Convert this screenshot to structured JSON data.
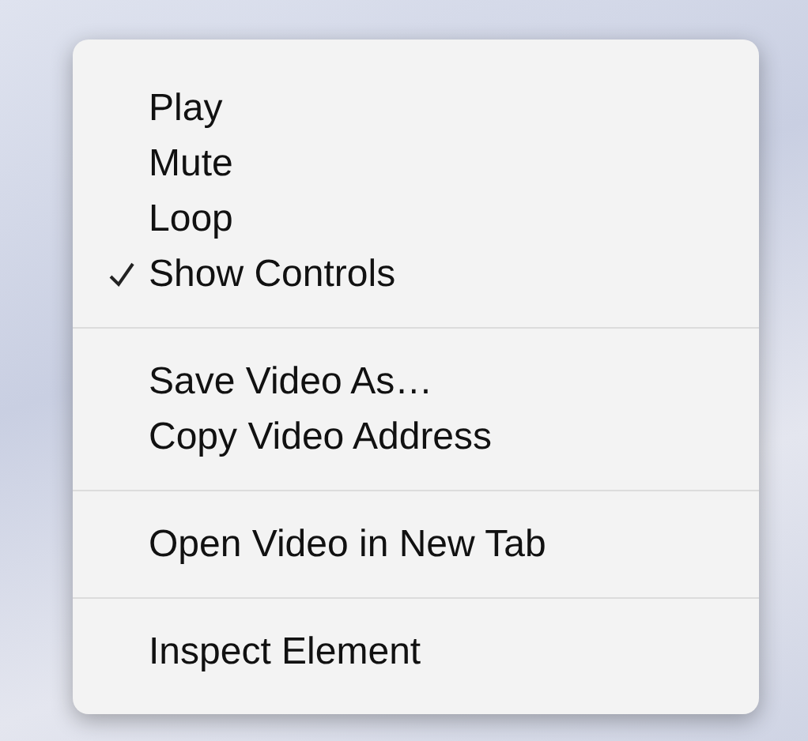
{
  "menu": {
    "groups": [
      {
        "items": [
          {
            "label": "Play",
            "checked": false
          },
          {
            "label": "Mute",
            "checked": false
          },
          {
            "label": "Loop",
            "checked": false
          },
          {
            "label": "Show Controls",
            "checked": true
          }
        ]
      },
      {
        "items": [
          {
            "label": "Save Video As…",
            "checked": false
          },
          {
            "label": "Copy Video Address",
            "checked": false
          }
        ]
      },
      {
        "items": [
          {
            "label": "Open Video in New Tab",
            "checked": false
          }
        ]
      },
      {
        "items": [
          {
            "label": "Inspect Element",
            "checked": false
          }
        ]
      }
    ]
  }
}
